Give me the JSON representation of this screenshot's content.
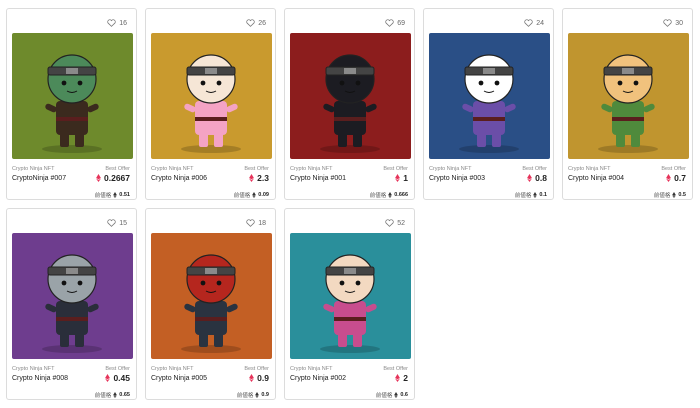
{
  "cards": [
    {
      "likes": "16",
      "collection": "Crypto Ninja NFT",
      "name": "CryptoNinja #007",
      "offer_label": "Best Offer",
      "price": "0.2667",
      "prev_label": "前値格",
      "prev_price": "0.51",
      "bg": "#6e8a2c"
    },
    {
      "likes": "26",
      "collection": "Crypto Ninja NFT",
      "name": "Crypto Ninja #006",
      "offer_label": "Best Offer",
      "price": "2.3",
      "prev_label": "前値格",
      "prev_price": "0.09",
      "bg": "#c99a2e"
    },
    {
      "likes": "69",
      "collection": "Crypto Ninja NFT",
      "name": "Crypto Ninja #001",
      "offer_label": "Best Offer",
      "price": "1",
      "prev_label": "前値格",
      "prev_price": "0.666",
      "bg": "#8c1d1d"
    },
    {
      "likes": "24",
      "collection": "Crypto Ninja NFT",
      "name": "Crypto Ninja #003",
      "offer_label": "Best Offer",
      "price": "0.8",
      "prev_label": "前値格",
      "prev_price": "0.1",
      "bg": "#2a4f86"
    },
    {
      "likes": "30",
      "collection": "Crypto Ninja NFT",
      "name": "Crypto Ninja #004",
      "offer_label": "Best Offer",
      "price": "0.7",
      "prev_label": "前値格",
      "prev_price": "0.5",
      "bg": "#c0952f"
    },
    {
      "likes": "15",
      "collection": "Crypto Ninja NFT",
      "name": "Crypto Ninja #008",
      "offer_label": "Best Offer",
      "price": "0.45",
      "prev_label": "前値格",
      "prev_price": "0.65",
      "bg": "#6e3d8e"
    },
    {
      "likes": "18",
      "collection": "Crypto Ninja NFT",
      "name": "Crypto Ninja #005",
      "offer_label": "Best Offer",
      "price": "0.9",
      "prev_label": "前値格",
      "prev_price": "0.9",
      "bg": "#c35f24"
    },
    {
      "likes": "52",
      "collection": "Crypto Ninja NFT",
      "name": "Crypto Ninja #002",
      "offer_label": "Best Offer",
      "price": "2",
      "prev_label": "前値格",
      "prev_price": "0.6",
      "bg": "#2a8f9b"
    }
  ],
  "colors": {
    "price_icon": "#e6335a",
    "border": "#dcdcdc"
  },
  "icons": {
    "like": "heart-icon",
    "price": "ethereum-icon",
    "prev": "ethereum-icon"
  }
}
